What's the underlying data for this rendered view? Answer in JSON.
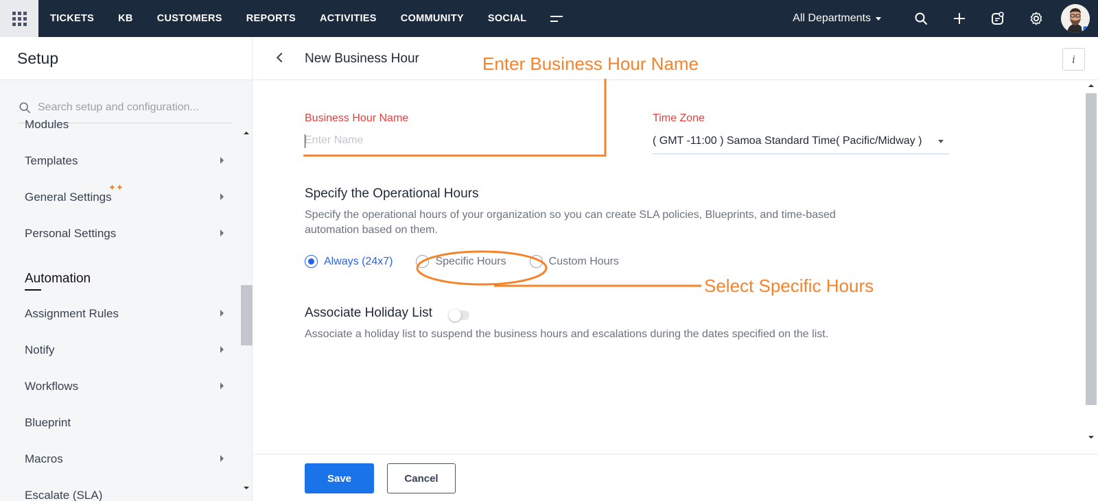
{
  "topnav": {
    "items": [
      "TICKETS",
      "KB",
      "CUSTOMERS",
      "REPORTS",
      "ACTIVITIES",
      "COMMUNITY",
      "SOCIAL"
    ],
    "department": "All Departments",
    "icons": [
      "apps-grid-icon",
      "more-menu-icon",
      "search-icon",
      "plus-icon",
      "compose-icon",
      "gear-icon",
      "avatar"
    ]
  },
  "sidebar": {
    "title": "Setup",
    "search_placeholder": "Search setup and configuration...",
    "partial_top": "Modules",
    "items_top": [
      "Templates",
      "General Settings",
      "Personal Settings"
    ],
    "section": "Automation",
    "items_automation": [
      "Assignment Rules",
      "Notify",
      "Workflows",
      "Blueprint",
      "Macros"
    ],
    "partial_bottom": "Escalate (SLA)"
  },
  "main": {
    "title": "New Business Hour",
    "info_label": "i",
    "name_label": "Business Hour Name",
    "name_placeholder": "Enter Name",
    "tz_label": "Time Zone",
    "tz_value": "( GMT -11:00 ) Samoa Standard Time( Pacific/Midway )",
    "op_heading": "Specify the Operational Hours",
    "op_desc_line1": "Specify the operational hours of your organization so you can create SLA policies, Blueprints, and time-based",
    "op_desc_line2": "automation based on them.",
    "radios": [
      "Always (24x7)",
      "Specific Hours",
      "Custom Hours"
    ],
    "selected_radio": "Always (24x7)",
    "holiday_heading": "Associate Holiday List",
    "holiday_desc": "Associate a holiday list to suspend the business hours and escalations during the dates specified on the list.",
    "holiday_enabled": false,
    "save_label": "Save",
    "cancel_label": "Cancel"
  },
  "annotations": {
    "name_hint": "Enter Business Hour Name",
    "specific_hint": "Select Specific Hours",
    "color": "#f5832a"
  },
  "colors": {
    "topbar": "#1b2a3d",
    "primary": "#1a73e8",
    "required_label": "#e53e3e"
  }
}
